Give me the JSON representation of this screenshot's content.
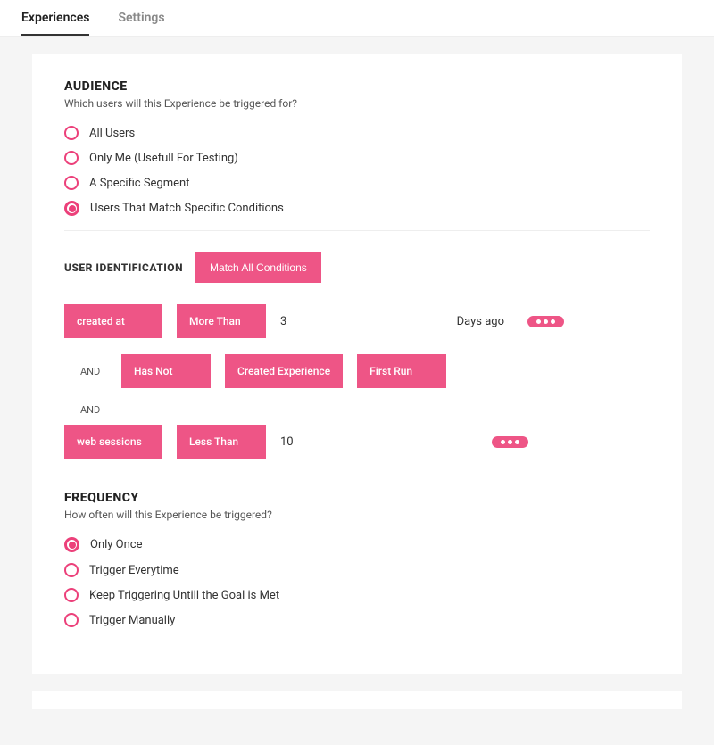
{
  "tabs": {
    "experiences": "Experiences",
    "settings": "Settings"
  },
  "audience": {
    "title": "AUDIENCE",
    "sub": "Which users will this Experience be triggered for?",
    "options": {
      "all": "All Users",
      "me": "Only Me (Usefull For Testing)",
      "segment": "A Specific Segment",
      "conditions": "Users That Match Specific Conditions"
    },
    "selected": "conditions"
  },
  "user_id": {
    "title": "USER IDENTIFICATION",
    "match_btn": "Match All Conditions",
    "row1": {
      "field": "created at",
      "op": "More Than",
      "value": "3",
      "suffix": "Days ago"
    },
    "and1": "AND",
    "row2": {
      "op": "Has Not",
      "what": "Created Experience",
      "which": "First Run"
    },
    "and2": "AND",
    "row3": {
      "field": "web sessions",
      "op": "Less Than",
      "value": "10"
    }
  },
  "frequency": {
    "title": "FREQUENCY",
    "sub": "How often will this Experience be triggered?",
    "options": {
      "once": "Only Once",
      "every": "Trigger Everytime",
      "goal": "Keep Triggering Untill the Goal is Met",
      "manual": "Trigger Manually"
    },
    "selected": "once"
  }
}
